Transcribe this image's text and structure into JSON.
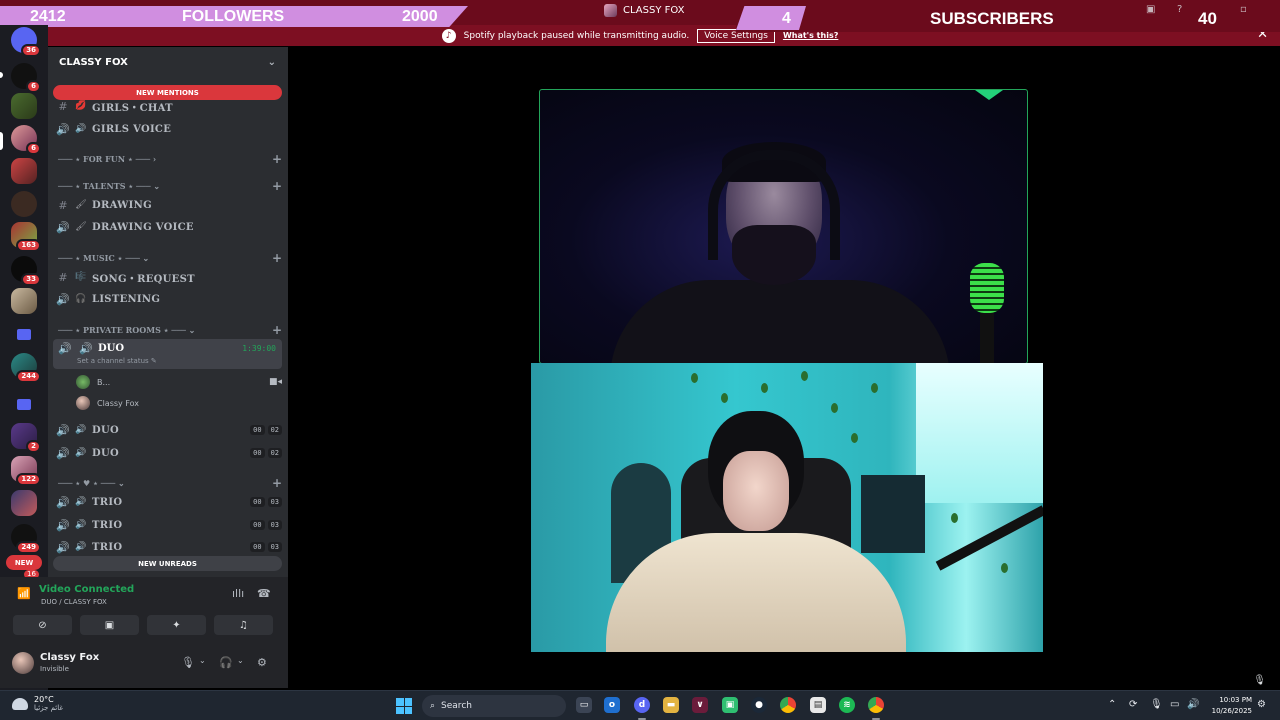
{
  "overlay": {
    "followers": {
      "current": "2412",
      "label": "FOLLOWERS",
      "goal": "2000"
    },
    "subscribers": {
      "count": "4",
      "label": "SUBSCRIBERS",
      "goal": "40"
    }
  },
  "window": {
    "title": "CLASSY FOX"
  },
  "banner": {
    "message": "Spotify playback paused while transmitting audio.",
    "button": "Voice Settings",
    "link": "What's this?"
  },
  "rail": {
    "badges": [
      "36",
      "6",
      "6",
      "163",
      "33",
      "244",
      "2",
      "122",
      "249",
      "16"
    ],
    "new_label": "NEW"
  },
  "server": {
    "name": "CLASSY FOX",
    "new_mentions": "NEW MENTIONS",
    "new_unreads": "NEW UNREADS",
    "channels": [
      {
        "type": "text",
        "emoji": "💋",
        "name": "GIRLS・CHAT"
      },
      {
        "type": "voice",
        "emoji": "🔊",
        "name": "GIRLS VOICE"
      },
      {
        "type": "category",
        "name": "─── ⋆ FOR FUN ⋆ ───  ›"
      },
      {
        "type": "category",
        "name": "─── ⋆ TALENTS ⋆ ───  ⌄"
      },
      {
        "type": "text",
        "emoji": "🖌",
        "name": "DRAWING"
      },
      {
        "type": "voice",
        "emoji": "🖌",
        "name": "DRAWING VOICE"
      },
      {
        "type": "category",
        "name": "─── ⋆ MUSIC ⋆ ───  ⌄"
      },
      {
        "type": "text",
        "emoji": "🎼",
        "name": "SONG・REQUEST"
      },
      {
        "type": "voice",
        "emoji": "🎧",
        "name": "LISTENING"
      },
      {
        "type": "category",
        "name": "─── ⋆ PRIVATE ROOMS ⋆ ───  ⌄"
      }
    ],
    "active_channel": {
      "name": "DUO",
      "status": "Set a channel status ✎",
      "time": "1:39:00"
    },
    "voice_users": [
      {
        "name": "B..."
      },
      {
        "name": "Classy Fox"
      }
    ],
    "rooms": [
      {
        "name": "DUO",
        "cur": "00",
        "max": "02"
      },
      {
        "name": "DUO",
        "cur": "00",
        "max": "02"
      },
      {
        "type": "category",
        "name": "─── ⋆ ♥ ⋆ ───  ⌄"
      },
      {
        "name": "TRIO",
        "cur": "00",
        "max": "03"
      },
      {
        "name": "TRIO",
        "cur": "00",
        "max": "03"
      },
      {
        "name": "TRIO",
        "cur": "00",
        "max": "03"
      }
    ]
  },
  "voice": {
    "status": "Video Connected",
    "channel": "DUO / CLASSY FOX"
  },
  "user": {
    "name": "Classy Fox",
    "status": "Invisible"
  },
  "taskbar": {
    "weather_temp": "20°C",
    "weather_cond": "غائم جزئيا",
    "search": "Search",
    "time": "10:03 PM",
    "date": "10/26/2025"
  },
  "colors": {
    "accent_green": "#23a55a",
    "mention_red": "#da373c",
    "overlay_pink": "#d08ee0",
    "overlay_maroon": "#6b0b1c"
  }
}
